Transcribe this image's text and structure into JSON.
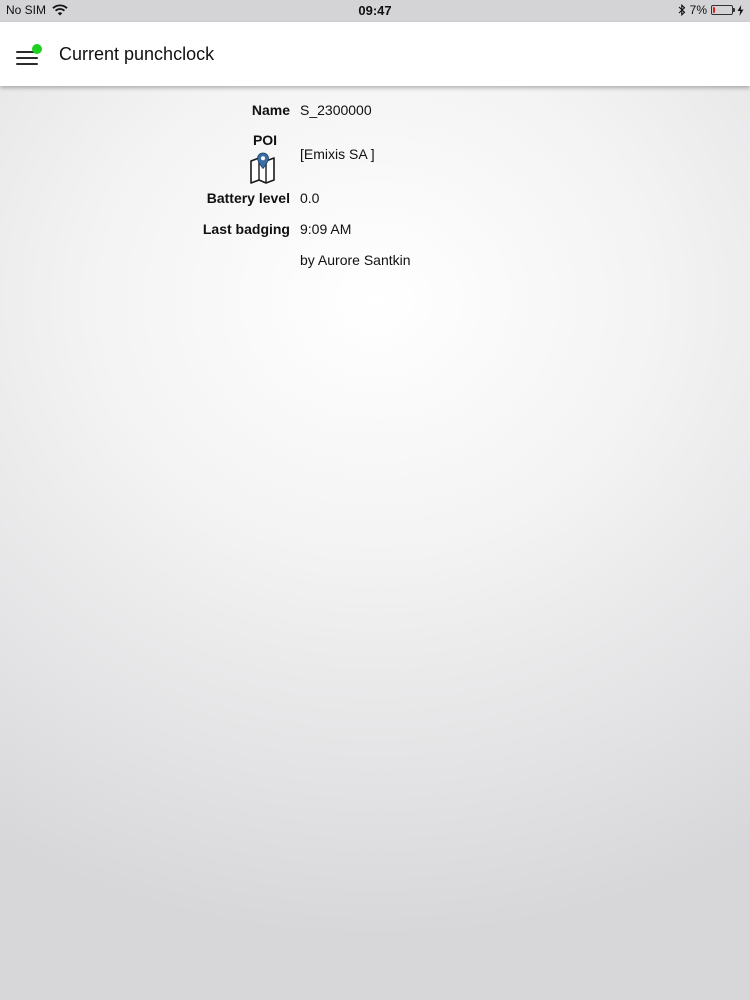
{
  "status_bar": {
    "carrier": "No SIM",
    "time": "09:47",
    "battery_percent_text": "7%",
    "battery_level": 0.07,
    "battery_color": "#e02020"
  },
  "header": {
    "title": "Current punchclock",
    "menu_icon": "hamburger-menu-icon",
    "status_dot_color": "#1ed01e"
  },
  "details": {
    "name_label": "Name",
    "name_value": "S_2300000",
    "poi_label": "POI",
    "poi_icon": "map-pin-icon",
    "poi_value": "[Emixis SA ]",
    "battery_label": "Battery level",
    "battery_value": "0.0",
    "last_badging_label": "Last badging",
    "last_badging_time": "9:09 AM",
    "last_badging_by": "by Aurore Santkin"
  }
}
